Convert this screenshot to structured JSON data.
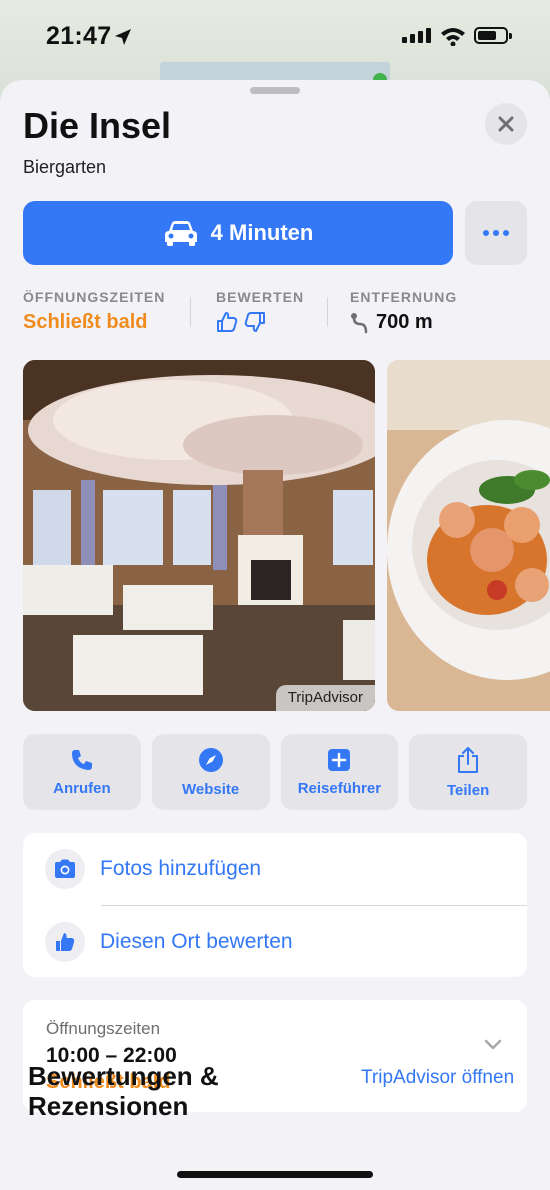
{
  "status_bar": {
    "time": "21:47"
  },
  "place": {
    "name": "Die Insel",
    "category": "Biergarten"
  },
  "route": {
    "label": "4 Minuten"
  },
  "info": {
    "hours_label": "ÖFFNUNGSZEITEN",
    "hours_value": "Schließt bald",
    "rate_label": "BEWERTEN",
    "distance_label": "ENTFERNUNG",
    "distance_value": "700 m"
  },
  "photos": {
    "attribution": "TripAdvisor"
  },
  "actions": [
    {
      "label": "Anrufen",
      "icon": "phone-icon"
    },
    {
      "label": "Website",
      "icon": "compass-icon"
    },
    {
      "label": "Reiseführer",
      "icon": "plus-square-icon"
    },
    {
      "label": "Teilen",
      "icon": "share-icon"
    }
  ],
  "contribute": {
    "add_photos": "Fotos hinzufügen",
    "rate_place": "Diesen Ort bewerten"
  },
  "hours_card": {
    "label": "Öffnungszeiten",
    "value": "10:00 – 22:00",
    "status": "Schließt bald"
  },
  "reviews": {
    "title": "Bewertungen & Rezensionen",
    "link": "TripAdvisor öffnen"
  },
  "colors": {
    "accent": "#3478f6",
    "warning": "#f08c1e"
  }
}
